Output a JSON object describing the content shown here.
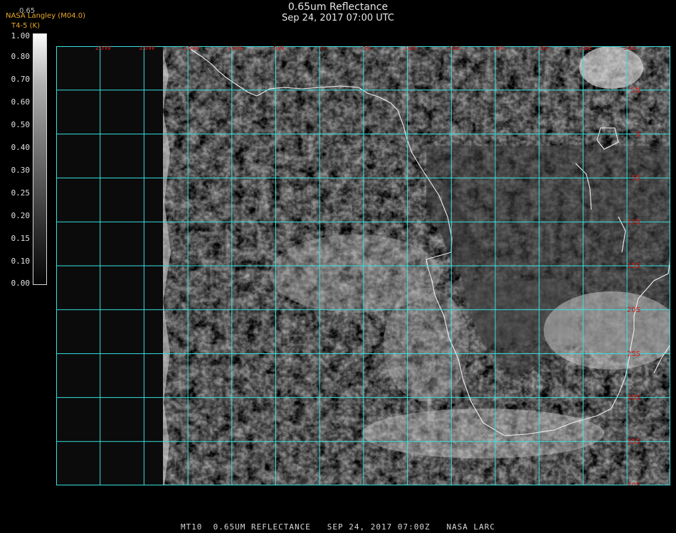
{
  "header": {
    "title": "0.65um Reflectance",
    "datetime": "Sep 24, 2017 07:00 UTC"
  },
  "credit": {
    "top_label": "0.65",
    "org": "NASA Langley (M04.0)",
    "variable": "T4-5 (K)"
  },
  "colorbar": {
    "labels": [
      "1.00",
      "0.80",
      "0.70",
      "0.60",
      "0.50",
      "0.40",
      "0.30",
      "0.25",
      "0.20",
      "0.15",
      "0.10",
      "0.00"
    ],
    "scale": "grayscale, black = 0.00, white = 1.00"
  },
  "map": {
    "lon_labels": [
      "25W",
      "20W",
      "15W",
      "10W",
      "5W",
      "0",
      "5E",
      "10E",
      "15E",
      "20E",
      "25E",
      "30E",
      "35E"
    ],
    "lat_labels": [
      "5N",
      "0",
      "5S",
      "10S",
      "15S",
      "20S",
      "25S",
      "30S",
      "35S",
      "40S"
    ],
    "grid_color": "#38e0e0",
    "coast_color": "#f0f0f0",
    "label_color": "#d81818"
  },
  "footer": {
    "text": "MT10  0.65UM REFLECTANCE   SEP 24, 2017 07:00Z   NASA LARC"
  }
}
